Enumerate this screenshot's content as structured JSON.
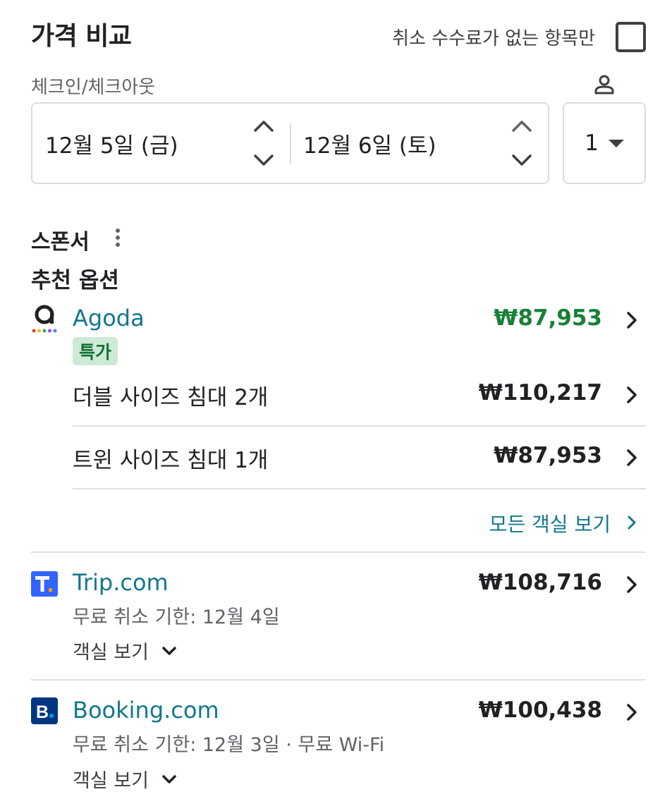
{
  "header": {
    "title": "가격 비교",
    "free_cancel_label": "취소 수수료가 없는 항목만"
  },
  "dates": {
    "label": "체크인/체크아웃",
    "checkin": "12월 5일 (금)",
    "checkout": "12월 6일 (토)",
    "guests": "1"
  },
  "sections": {
    "sponsor": "스폰서",
    "recommended": "추천 옵션"
  },
  "agoda": {
    "name": "Agoda",
    "price": "₩87,953",
    "price_color": "#188038",
    "badge": "특가",
    "rooms": [
      {
        "name": "더블 사이즈 침대 2개",
        "price": "₩110,217"
      },
      {
        "name": "트윈 사이즈 침대 1개",
        "price": "₩87,953"
      }
    ],
    "all_rooms_label": "모든 객실 보기"
  },
  "trip": {
    "logo_letter": "T.",
    "name": "Trip.com",
    "price": "₩108,716",
    "sub": "무료 취소 기한: 12월 4일",
    "rooms_toggle": "객실 보기"
  },
  "booking": {
    "logo_letter": "B.",
    "name": "Booking.com",
    "price": "₩100,438",
    "sub": "무료 취소 기한: 12월 3일 · 무료 Wi-Fi",
    "rooms_toggle": "객실 보기"
  },
  "colors": {
    "link": "#11788c",
    "deal_price": "#188038",
    "badge_bg": "#ceead6",
    "trip_logo": "#3264ff",
    "booking_logo": "#003580"
  },
  "icons": [
    "person-icon",
    "chevron-up-icon",
    "chevron-down-icon",
    "caret-down-icon",
    "more-vert-icon",
    "chevron-right-icon",
    "agoda-logo",
    "trip-logo",
    "booking-logo"
  ]
}
